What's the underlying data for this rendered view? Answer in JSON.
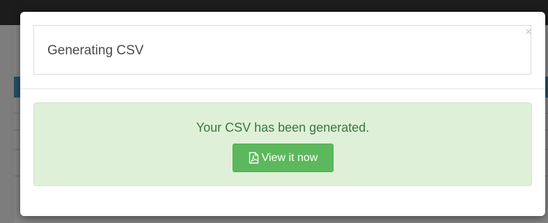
{
  "modal": {
    "title": "Generating CSV",
    "close_label": "×"
  },
  "alert": {
    "message": "Your CSV has been generated.",
    "button_label": "View it now",
    "button_icon": "pdf-file-icon"
  },
  "colors": {
    "alert_bg": "#dff0d8",
    "alert_text": "#3c763d",
    "button_bg": "#5cb85c",
    "backdrop": "#7d7d7d"
  }
}
